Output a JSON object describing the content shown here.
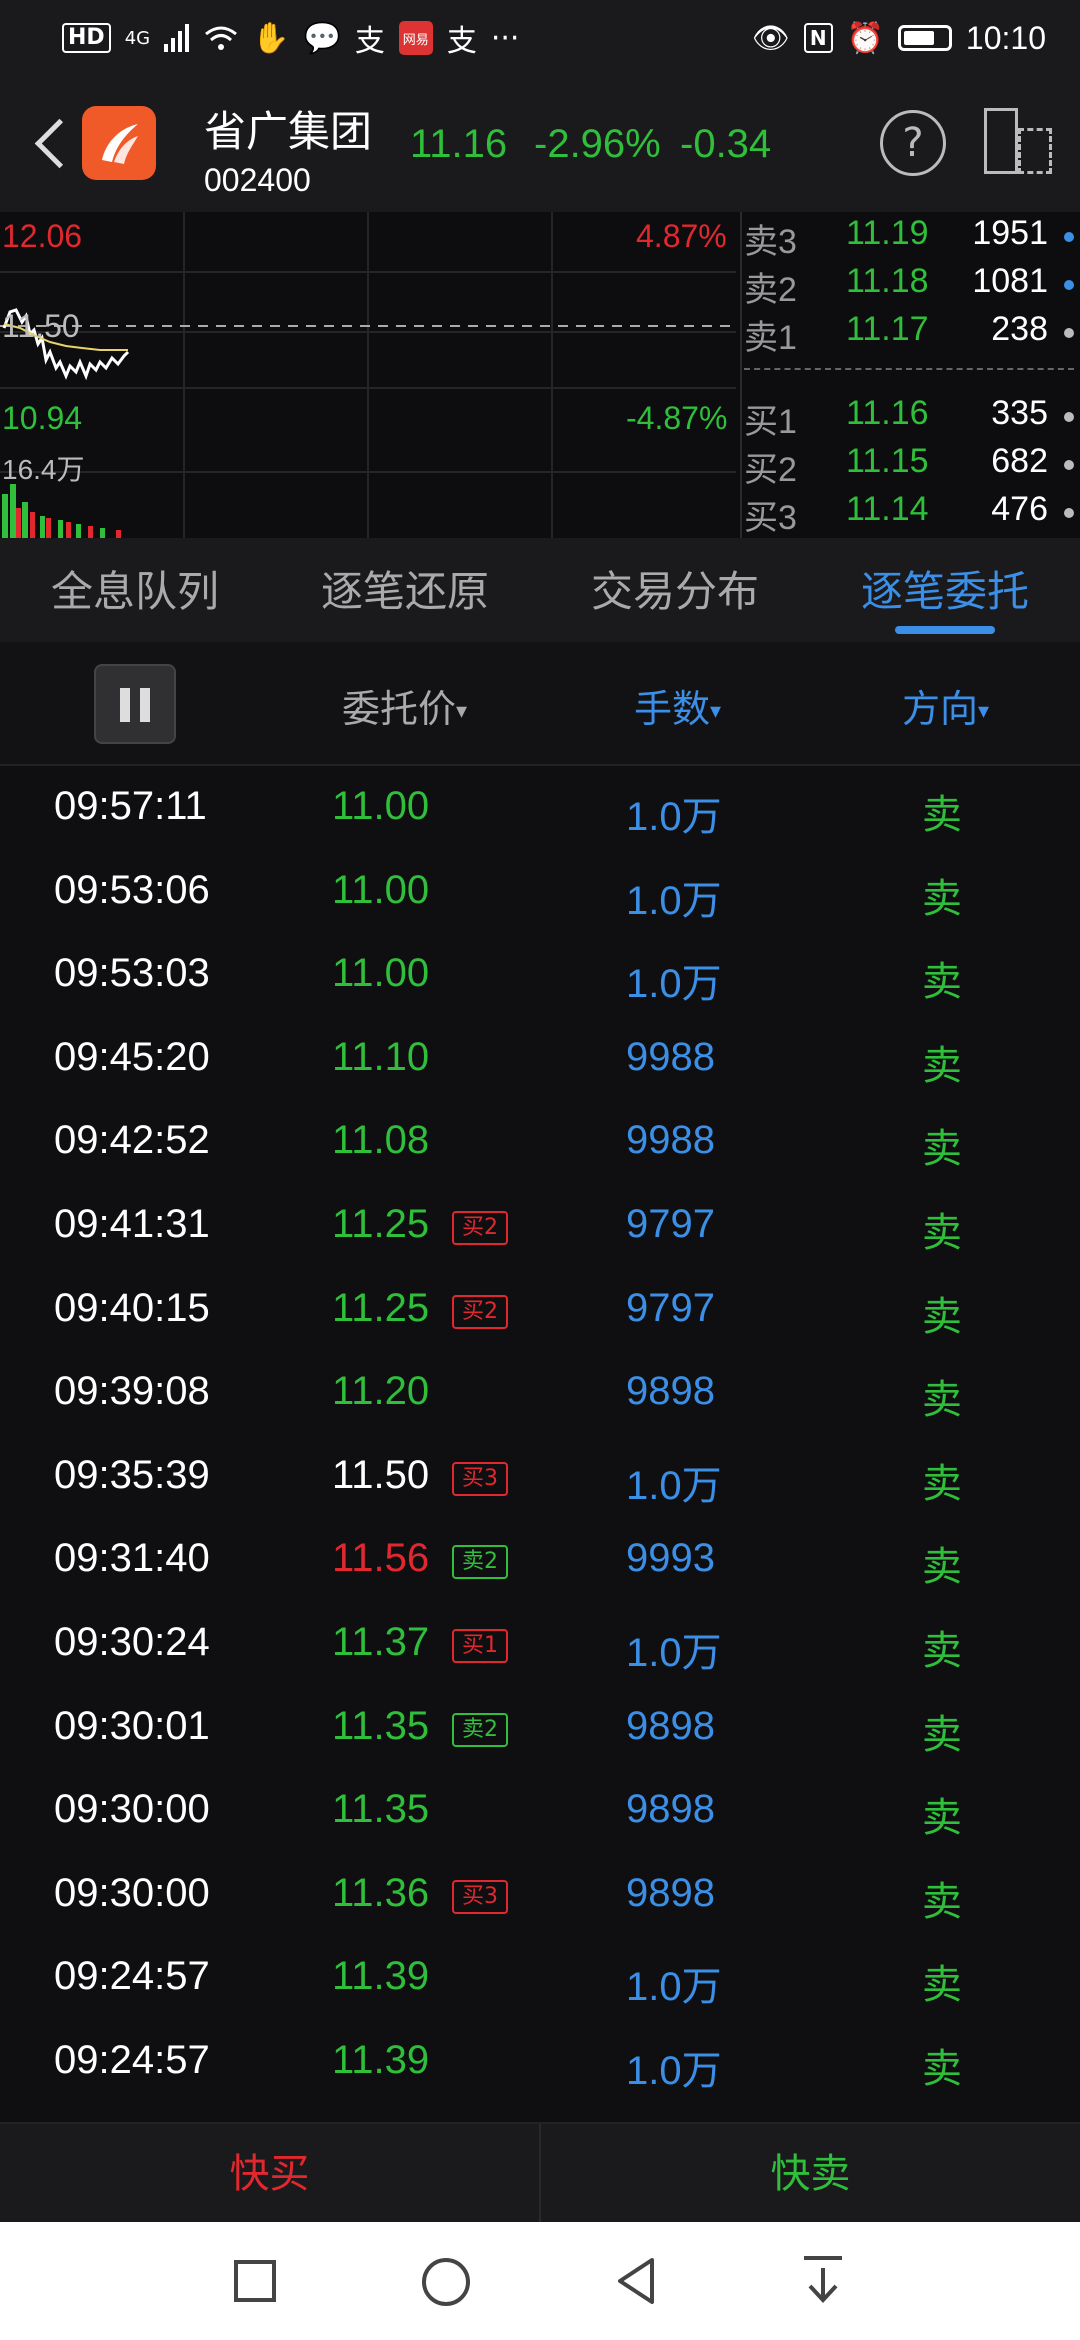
{
  "status_bar": {
    "chip": "HD",
    "network": "4G",
    "glyph_alipay": "支",
    "glyph_netease": "网易",
    "glyph_alipay2": "支",
    "more": "···",
    "time": "10:10"
  },
  "header": {
    "name": "省广集团",
    "code": "002400",
    "price": "11.16",
    "change_pct": "-2.96%",
    "change": "-0.34",
    "help": "?"
  },
  "mini_chart": {
    "high": "12.06",
    "high_pct": "4.87%",
    "mid": "11.50",
    "low": "10.94",
    "low_pct": "-4.87%",
    "volume": "16.4万"
  },
  "depth": {
    "asks": [
      {
        "label": "卖3",
        "price": "11.19",
        "vol": "1951"
      },
      {
        "label": "卖2",
        "price": "11.18",
        "vol": "1081"
      },
      {
        "label": "卖1",
        "price": "11.17",
        "vol": "238"
      }
    ],
    "bids": [
      {
        "label": "买1",
        "price": "11.16",
        "vol": "335"
      },
      {
        "label": "买2",
        "price": "11.15",
        "vol": "682"
      },
      {
        "label": "买3",
        "price": "11.14",
        "vol": "476"
      }
    ]
  },
  "tabs": [
    "全息队列",
    "逐笔还原",
    "交易分布",
    "逐笔委托"
  ],
  "columns": {
    "price": "委托价",
    "qty": "手数",
    "dir": "方向",
    "caret": "▾"
  },
  "orders": [
    {
      "time": "09:57:11",
      "price": "11.00",
      "color": "green",
      "tag": "",
      "qty": "1.0万",
      "dir": "卖"
    },
    {
      "time": "09:53:06",
      "price": "11.00",
      "color": "green",
      "tag": "",
      "qty": "1.0万",
      "dir": "卖"
    },
    {
      "time": "09:53:03",
      "price": "11.00",
      "color": "green",
      "tag": "",
      "qty": "1.0万",
      "dir": "卖"
    },
    {
      "time": "09:45:20",
      "price": "11.10",
      "color": "green",
      "tag": "",
      "qty": "9988",
      "dir": "卖"
    },
    {
      "time": "09:42:52",
      "price": "11.08",
      "color": "green",
      "tag": "",
      "qty": "9988",
      "dir": "卖"
    },
    {
      "time": "09:41:31",
      "price": "11.25",
      "color": "green",
      "tag": "买2",
      "qty": "9797",
      "dir": "卖"
    },
    {
      "time": "09:40:15",
      "price": "11.25",
      "color": "green",
      "tag": "买2",
      "qty": "9797",
      "dir": "卖"
    },
    {
      "time": "09:39:08",
      "price": "11.20",
      "color": "green",
      "tag": "",
      "qty": "9898",
      "dir": "卖"
    },
    {
      "time": "09:35:39",
      "price": "11.50",
      "color": "white",
      "tag": "买3",
      "qty": "1.0万",
      "dir": "卖"
    },
    {
      "time": "09:31:40",
      "price": "11.56",
      "color": "red",
      "tag": "卖2",
      "qty": "9993",
      "dir": "卖"
    },
    {
      "time": "09:30:24",
      "price": "11.37",
      "color": "green",
      "tag": "买1",
      "qty": "1.0万",
      "dir": "卖"
    },
    {
      "time": "09:30:01",
      "price": "11.35",
      "color": "green",
      "tag": "卖2",
      "qty": "9898",
      "dir": "卖"
    },
    {
      "time": "09:30:00",
      "price": "11.35",
      "color": "green",
      "tag": "",
      "qty": "9898",
      "dir": "卖"
    },
    {
      "time": "09:30:00",
      "price": "11.36",
      "color": "green",
      "tag": "买3",
      "qty": "9898",
      "dir": "卖"
    },
    {
      "time": "09:24:57",
      "price": "11.39",
      "color": "green",
      "tag": "",
      "qty": "1.0万",
      "dir": "卖"
    },
    {
      "time": "09:24:57",
      "price": "11.39",
      "color": "green",
      "tag": "",
      "qty": "1.0万",
      "dir": "卖"
    }
  ],
  "quick": {
    "buy": "快买",
    "sell": "快卖"
  },
  "colors": {
    "up": "#e0282e",
    "down": "#2fbf3a",
    "accent": "#3c8fe6"
  }
}
